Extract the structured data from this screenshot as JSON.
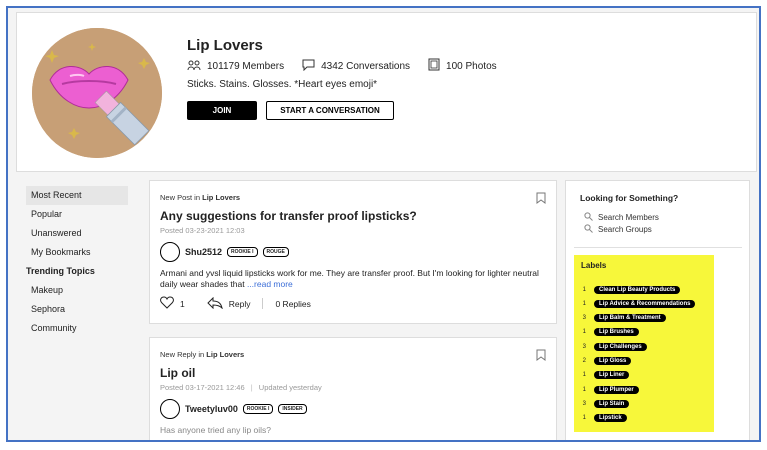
{
  "group": {
    "title": "Lip Lovers",
    "members": "101179 Members",
    "conversations": "4342 Conversations",
    "photos": "100 Photos",
    "description": "Sticks. Stains. Glosses. *Heart eyes emoji*",
    "join_label": "JOIN",
    "start_label": "START A CONVERSATION"
  },
  "nav": {
    "items": [
      "Most Recent",
      "Popular",
      "Unanswered",
      "My Bookmarks"
    ],
    "trending_heading": "Trending Topics",
    "topics": [
      "Makeup",
      "Sephora",
      "Community"
    ]
  },
  "posts": [
    {
      "type_prefix": "New Post in",
      "group": "Lip Lovers",
      "title": "Any suggestions for transfer proof lipsticks?",
      "date": "Posted 03-23-2021 12:03",
      "author": "Shu2512",
      "badges": [
        "ROOKIE I",
        "ROUGE"
      ],
      "body": "Armani and yvsl liquid lipsticks work for me. They are transfer proof. But I'm looking for lighter neutral daily wear shades that ",
      "more": "...read more",
      "likes": "1",
      "reply_label": "Reply",
      "replies": "0 Replies"
    },
    {
      "type_prefix": "New Reply in",
      "group": "Lip Lovers",
      "title": "Lip oil",
      "date": "Posted 03-17-2021 12:46",
      "updated": "Updated yesterday",
      "author": "Tweetyluv00",
      "badges": [
        "ROOKIE I",
        "INSIDER"
      ],
      "body": "Has anyone tried any lip oils?"
    }
  ],
  "sidebar": {
    "title": "Looking for Something?",
    "search_members": "Search Members",
    "search_groups": "Search Groups",
    "labels_title": "Labels",
    "labels": [
      {
        "count": "1",
        "name": "Clean Lip Beauty Products"
      },
      {
        "count": "1",
        "name": "Lip Advice & Recommendations"
      },
      {
        "count": "3",
        "name": "Lip Balm & Treatment"
      },
      {
        "count": "1",
        "name": "Lip Brushes"
      },
      {
        "count": "3",
        "name": "Lip Challenges"
      },
      {
        "count": "2",
        "name": "Lip Gloss"
      },
      {
        "count": "1",
        "name": "Lip Liner"
      },
      {
        "count": "1",
        "name": "Lip Plumper"
      },
      {
        "count": "3",
        "name": "Lip Stain"
      },
      {
        "count": "1",
        "name": "Lipstick"
      }
    ]
  },
  "colors": {
    "frame": "#4472c4",
    "labels_bg": "#f7f73a",
    "link": "#3d6fd8"
  }
}
